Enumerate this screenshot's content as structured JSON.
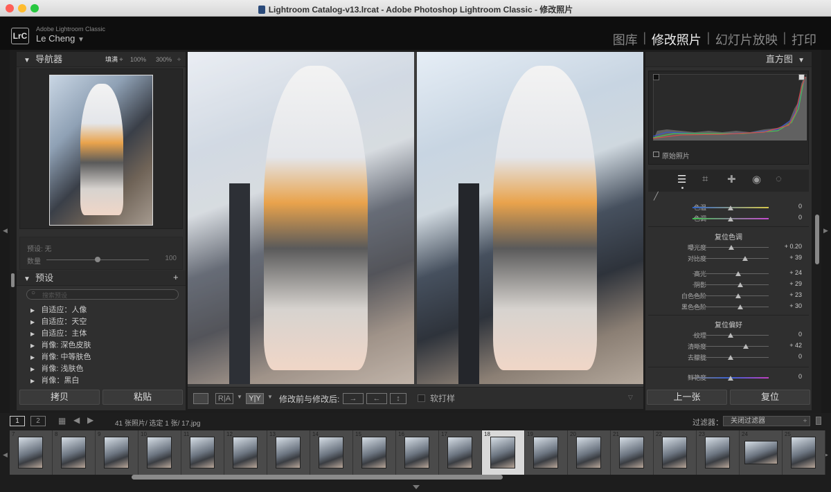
{
  "window": {
    "title": "Lightroom Catalog-v13.lrcat - Adobe Photoshop Lightroom Classic - 修改照片"
  },
  "identity": {
    "logo": "LrC",
    "product": "Adobe Lightroom Classic",
    "user": "Le Cheng"
  },
  "modules": [
    "图库",
    "修改照片",
    "幻灯片放映",
    "打印"
  ],
  "active_module": "修改照片",
  "navigator": {
    "title": "导航器",
    "zoom_options": [
      "填满",
      "100%",
      "300%"
    ]
  },
  "preset_amount": {
    "preset_label": "预设: 无",
    "amount_label": "数量",
    "amount_value": "100"
  },
  "presets": {
    "title": "预设",
    "search_placeholder": "搜索预设",
    "items": [
      "自适应：人像",
      "自适应：天空",
      "自适应：主体",
      "肖像: 深色皮肤",
      "肖像: 中等肤色",
      "肖像: 浅肤色",
      "肖像：黑白"
    ]
  },
  "left_buttons": {
    "copy": "拷贝",
    "paste": "粘贴"
  },
  "toolbar": {
    "before_after_label": "修改前与修改后:",
    "soft_proof_label": "软打样"
  },
  "histogram": {
    "title": "直方图",
    "original_photo_label": "原始照片"
  },
  "basic": {
    "temp": {
      "label": "色温",
      "value": "0",
      "pos": 0.5
    },
    "tint": {
      "label": "色调",
      "value": "0",
      "pos": 0.5
    },
    "tone_header": "复位色调",
    "exposure": {
      "label": "曝光度",
      "value": "+ 0.20",
      "pos": 0.51
    },
    "contrast": {
      "label": "对比度",
      "value": "+ 39",
      "pos": 0.69
    },
    "highlights": {
      "label": "高光",
      "value": "+ 24",
      "pos": 0.6
    },
    "shadows": {
      "label": "阴影",
      "value": "+ 29",
      "pos": 0.63
    },
    "whites": {
      "label": "白色色阶",
      "value": "+ 23",
      "pos": 0.6
    },
    "blacks": {
      "label": "黑色色阶",
      "value": "+ 30",
      "pos": 0.63
    },
    "presence_header": "复位偏好",
    "texture": {
      "label": "纹理",
      "value": "0",
      "pos": 0.5
    },
    "clarity": {
      "label": "清晰度",
      "value": "+ 42",
      "pos": 0.7
    },
    "dehaze": {
      "label": "去朦胧",
      "value": "0",
      "pos": 0.5
    },
    "vibrance": {
      "label": "鲜艳度",
      "value": "0",
      "pos": 0.5
    }
  },
  "right_buttons": {
    "previous": "上一张",
    "reset": "复位"
  },
  "filmstrip": {
    "page1": "1",
    "page2": "2",
    "info": "41 张照片/ 选定 1 张/ 17.jpg",
    "filter_label": "过滤器：",
    "filter_value": "关闭过滤器",
    "selected_number": "18",
    "numbers": [
      "7",
      "8",
      "9",
      "10",
      "11",
      "12",
      "13",
      "14",
      "15",
      "16",
      "17",
      "18",
      "19",
      "20",
      "21",
      "22",
      "23",
      "24",
      "25"
    ]
  }
}
